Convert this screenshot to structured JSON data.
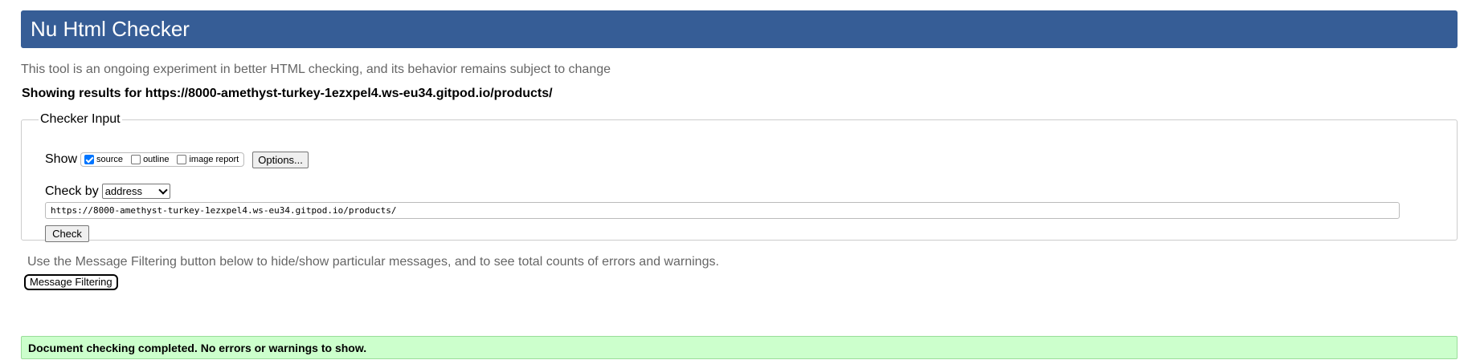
{
  "header": {
    "title": "Nu Html Checker"
  },
  "intro_text": "This tool is an ongoing experiment in better HTML checking, and its behavior remains subject to change",
  "results_for": "Showing results for https://8000-amethyst-turkey-1ezxpel4.ws-eu34.gitpod.io/products/",
  "checker_input": {
    "legend": "Checker Input",
    "show_label": "Show",
    "options": [
      {
        "label": "source",
        "checked": true
      },
      {
        "label": "outline",
        "checked": false
      },
      {
        "label": "image report",
        "checked": false
      }
    ],
    "options_button": "Options...",
    "check_by_label": "Check by",
    "check_by_value": "address",
    "url_value": "https://8000-amethyst-turkey-1ezxpel4.ws-eu34.gitpod.io/products/",
    "check_button": "Check"
  },
  "filtering": {
    "note": "Use the Message Filtering button below to hide/show particular messages, and to see total counts of errors and warnings.",
    "button": "Message Filtering"
  },
  "status": {
    "message": "Document checking completed. No errors or warnings to show.",
    "color": "#ccffcc"
  },
  "colors": {
    "header_bg": "#365d96",
    "checkbox_checked": "#0075ff"
  },
  "icons": {
    "select_arrow": "chevron-down-icon",
    "checkbox_check": "checkmark-icon"
  }
}
